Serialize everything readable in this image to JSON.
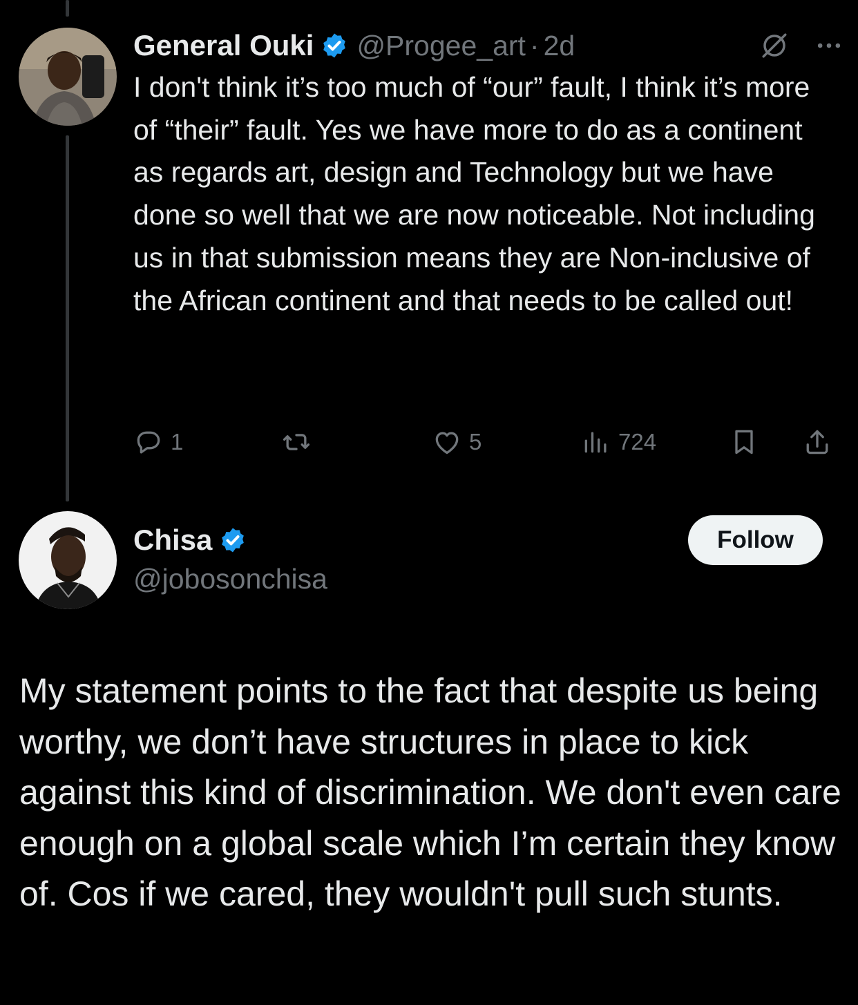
{
  "reply": {
    "display_name": "General Ouki",
    "handle": "@Progee_art",
    "separator": "·",
    "timestamp": "2d",
    "text": "I don't think it’s too much of “our” fault, I think it’s more of “their” fault. Yes we have more to do as a continent as regards art, design and Technology but we have done so well that we are now noticeable. Not including us in that submission means they are Non-inclusive of the African continent and that needs to be called out!",
    "icons": {
      "verified": "verified-badge-icon",
      "grok": "grok-icon",
      "more": "more-icon"
    },
    "actions": {
      "reply_count": "1",
      "repost_count": "",
      "like_count": "5",
      "views_count": "724"
    }
  },
  "main_post": {
    "display_name": "Chisa",
    "handle": "@jobosonchisa",
    "follow_label": "Follow",
    "text": "My statement points to the fact that despite us being worthy, we don’t have structures in place to kick against this kind of discrimination. We don't even care enough on a global scale which I’m certain they know of. Cos if we cared, they wouldn't pull such stunts."
  },
  "colors": {
    "background": "#000000",
    "text_primary": "#e7e9ea",
    "text_secondary": "#71767b",
    "verified_blue": "#1d9bf0",
    "thread_line": "#333639",
    "follow_bg": "#eff3f4"
  }
}
